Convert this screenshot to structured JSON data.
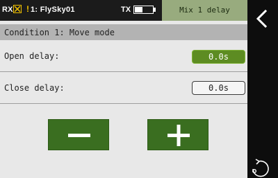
{
  "status_bar": {
    "rx_label": "RX",
    "rx_signal_icon": "x-box-icon",
    "rx_alert": "!",
    "model_name": "1: FlySky01",
    "tx_label": "TX",
    "tx_battery_level": 0.45,
    "page_title": "Mix 1 delay",
    "colors": {
      "bar_bg": "#1b1b1b",
      "warning": "#f2c200",
      "title_bg": "#98ab7e"
    }
  },
  "section": {
    "title": "Condition 1: Move mode"
  },
  "settings": [
    {
      "label": "Open delay:",
      "value": "0.0s",
      "active": true
    },
    {
      "label": "Close delay:",
      "value": "0.0s",
      "active": false
    }
  ],
  "controls": {
    "decrement_icon": "minus-icon",
    "increment_icon": "plus-icon",
    "button_color": "#3a6e20"
  },
  "side_nav": {
    "back_icon": "chevron-left-icon",
    "reload_icon": "reload-icon"
  }
}
